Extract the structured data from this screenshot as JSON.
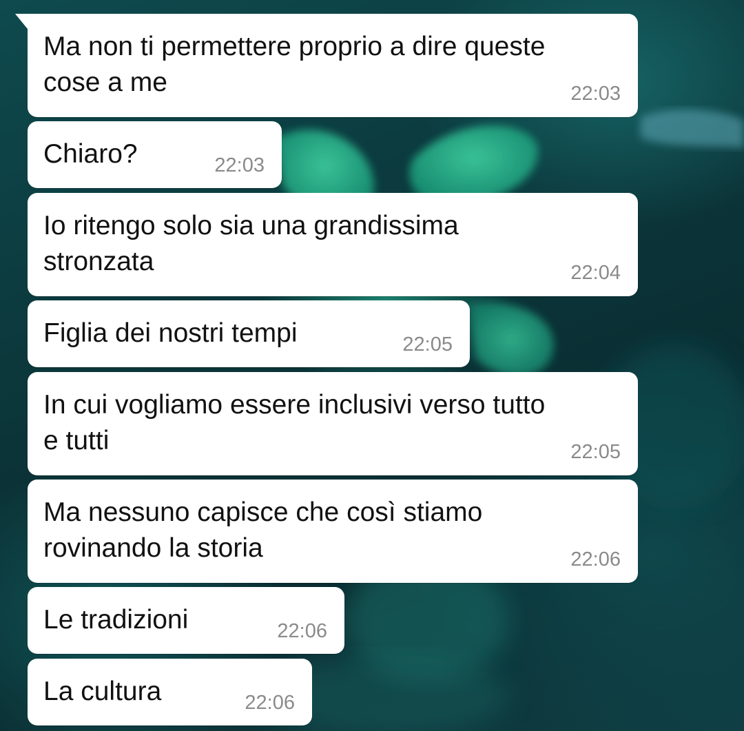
{
  "messages": [
    {
      "text": "Ma non ti permettere proprio a dire queste\ncose a me",
      "time": "22:03"
    },
    {
      "text": "Chiaro?",
      "time": "22:03"
    },
    {
      "text": "Io ritengo solo sia una grandissima\nstronzata",
      "time": "22:04"
    },
    {
      "text": "Figlia dei nostri tempi",
      "time": "22:05"
    },
    {
      "text": "In cui vogliamo essere inclusivi verso tutto\ne tutti",
      "time": "22:05"
    },
    {
      "text": "Ma nessuno capisce che così stiamo\nrovinando la storia",
      "time": "22:06"
    },
    {
      "text": "Le tradizioni",
      "time": "22:06"
    },
    {
      "text": "La cultura",
      "time": "22:06"
    }
  ],
  "colors": {
    "bubble": "#ffffff",
    "text": "#111111",
    "timestamp": "#8a8a8a",
    "wallpaper": "#0d3b3f"
  }
}
